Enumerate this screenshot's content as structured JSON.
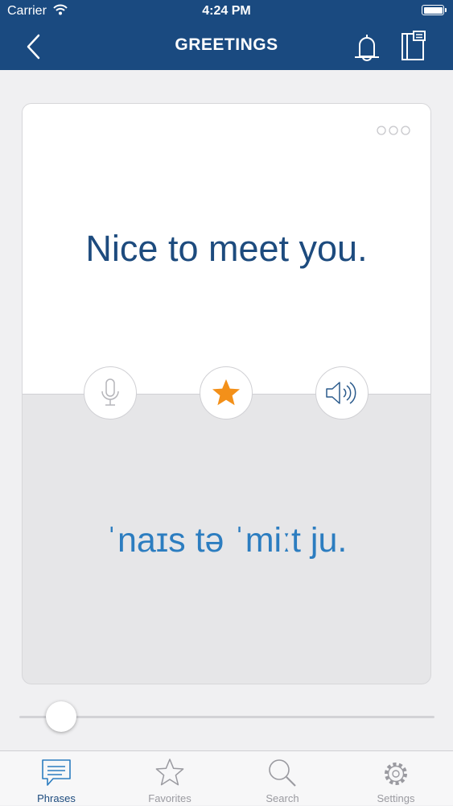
{
  "status_bar": {
    "carrier": "Carrier",
    "time": "4:24 PM"
  },
  "header": {
    "title": "GREETINGS"
  },
  "card": {
    "phrase": "Nice to meet you.",
    "phonetic": "ˈnaɪs tə ˈmiːt ju.",
    "favorite": true
  },
  "slider": {
    "value": 0.04
  },
  "tabs": [
    {
      "label": "Phrases",
      "active": true
    },
    {
      "label": "Favorites",
      "active": false
    },
    {
      "label": "Search",
      "active": false
    },
    {
      "label": "Settings",
      "active": false
    }
  ],
  "colors": {
    "header_bg": "#1a4a80",
    "phrase_text": "#1d4b7e",
    "phonetic_text": "#2c7dc0",
    "favorite_star": "#f39019"
  }
}
